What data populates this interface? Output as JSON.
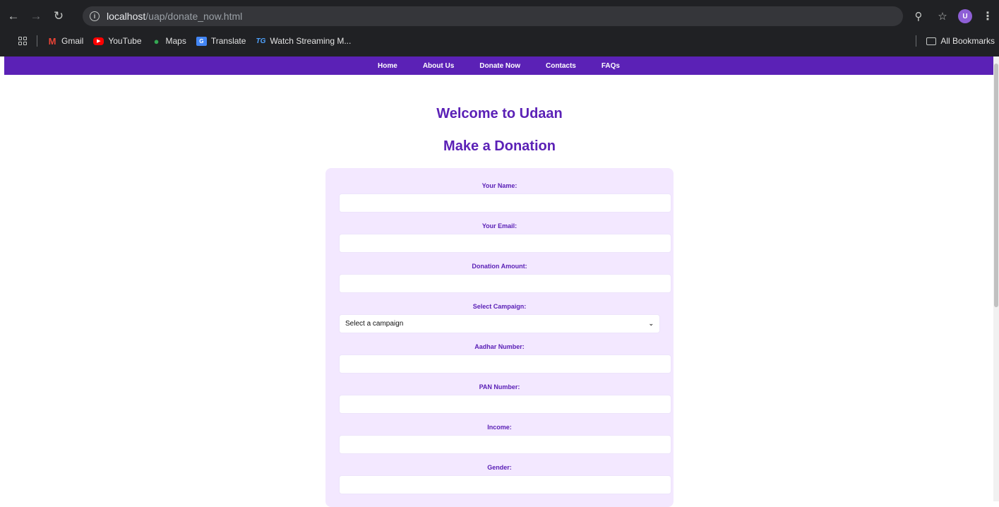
{
  "browser": {
    "url_host": "localhost",
    "url_path": "/uap/donate_now.html",
    "profile_initial": "U",
    "bookmarks": [
      {
        "label": "Gmail"
      },
      {
        "label": "YouTube"
      },
      {
        "label": "Maps"
      },
      {
        "label": "Translate"
      },
      {
        "label": "Watch Streaming M..."
      }
    ],
    "all_bookmarks_label": "All Bookmarks"
  },
  "nav": {
    "items": [
      "Home",
      "About Us",
      "Donate Now",
      "Contacts",
      "FAQs"
    ]
  },
  "page": {
    "welcome_heading": "Welcome to Udaan",
    "donation_heading": "Make a Donation"
  },
  "form": {
    "name_label": "Your Name:",
    "email_label": "Your Email:",
    "amount_label": "Donation Amount:",
    "campaign_label": "Select Campaign:",
    "campaign_selected": "Select a campaign",
    "aadhar_label": "Aadhar Number:",
    "pan_label": "PAN Number:",
    "income_label": "Income:",
    "gender_label": "Gender:"
  },
  "colors": {
    "brand_purple": "#5b21b6",
    "form_background": "#f3e8ff"
  }
}
